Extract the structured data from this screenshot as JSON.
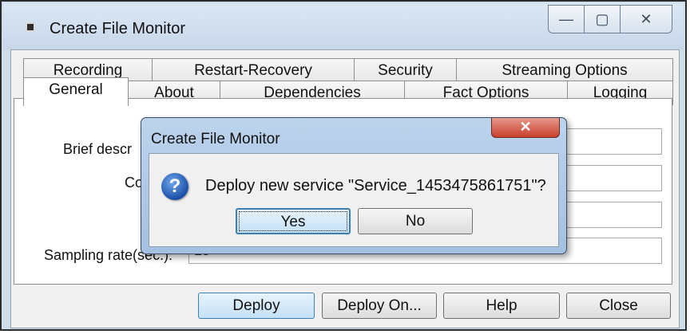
{
  "window": {
    "title": "Create File Monitor",
    "buttons": {
      "minimize": "—",
      "maximize": "▢",
      "close": "✕"
    }
  },
  "tabs": {
    "row1": [
      "Recording",
      "Restart-Recovery",
      "Security",
      "Streaming Options"
    ],
    "row2": [
      "General",
      "About",
      "Dependencies",
      "Fact Options",
      "Logging"
    ],
    "active": "General"
  },
  "form": {
    "brief_description_label": "Brief descr",
    "second_label": "Co",
    "sampling_rate_label": "Sampling rate(sec.):",
    "sampling_rate_value": "15"
  },
  "footer": {
    "deploy": "Deploy",
    "deploy_on": "Deploy On...",
    "help": "Help",
    "close": "Close"
  },
  "dialog": {
    "title": "Create File Monitor",
    "close": "✕",
    "icon": "question-icon",
    "message": "Deploy new service \"Service_1453475861751\"?",
    "yes": "Yes",
    "no": "No"
  },
  "colors": {
    "titlebar": "#c7d7ea",
    "dialog_frame": "#a5c0e0",
    "close_red": "#c8402c",
    "default_button": "#c4e0f6"
  }
}
